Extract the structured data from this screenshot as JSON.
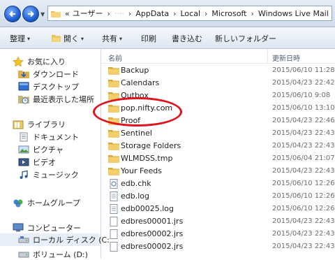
{
  "address_bar": {
    "back_icon": "back-arrow-icon",
    "forward_icon": "forward-arrow-icon",
    "overflow_marker": "«",
    "breadcrumbs": [
      "ユーザー",
      "····",
      "AppData",
      "Local",
      "Microsoft",
      "Windows Live Mail"
    ],
    "separator": "›"
  },
  "toolbar": {
    "organize": "整理",
    "open": "開く",
    "share": "共有",
    "print": "印刷",
    "burn": "書き込む",
    "new_folder": "新しいフォルダー",
    "dropdown_glyph": "▾"
  },
  "sidebar": {
    "favorites": "お気に入り",
    "downloads": "ダウンロード",
    "desktop": "デスクトップ",
    "recent": "最近表示した場所",
    "libraries": "ライブラリ",
    "documents": "ドキュメント",
    "pictures": "ピクチャ",
    "videos": "ビデオ",
    "music": "ミュージック",
    "homegroup": "ホームグループ",
    "computer": "コンピューター",
    "local_disk": "ローカル ディスク (C:",
    "volume_d": "ボリューム (D:)"
  },
  "columns": {
    "name": "名前",
    "date": "更新日時"
  },
  "files": [
    {
      "name": "Backup",
      "date": "2015/06/10 11:28",
      "kind": "folder"
    },
    {
      "name": "Calendars",
      "date": "2015/04/23 22:42",
      "kind": "folder"
    },
    {
      "name": "Outbox",
      "date": "2015/06/10 9:08",
      "kind": "folder"
    },
    {
      "name": "pop.nifty.com",
      "date": "2015/06/10 13:10",
      "kind": "folder"
    },
    {
      "name": "Proof",
      "date": "2015/04/23 22:46",
      "kind": "folder"
    },
    {
      "name": "Sentinel",
      "date": "2015/04/23 22:43",
      "kind": "folder"
    },
    {
      "name": "Storage Folders",
      "date": "2015/04/23 22:43",
      "kind": "folder"
    },
    {
      "name": "WLMDSS.tmp",
      "date": "2015/06/04 21:07",
      "kind": "folder"
    },
    {
      "name": "Your Feeds",
      "date": "2015/04/23 22:43",
      "kind": "folder"
    },
    {
      "name": "edb.chk",
      "date": "2015/06/10 12:26",
      "kind": "chk"
    },
    {
      "name": "edb.log",
      "date": "2015/06/10 12:26",
      "kind": "log"
    },
    {
      "name": "edb00025.log",
      "date": "2015/06/10 12:26",
      "kind": "log"
    },
    {
      "name": "edbres00001.jrs",
      "date": "2015/04/23 22:43",
      "kind": "file"
    },
    {
      "name": "edbres00002.jrs",
      "date": "2015/04/23 22:43",
      "kind": "file"
    },
    {
      "name": "edbres00002.jrs",
      "date": "2015/04/23 22:43",
      "kind": "file"
    }
  ],
  "highlight_color": "#e0121b"
}
